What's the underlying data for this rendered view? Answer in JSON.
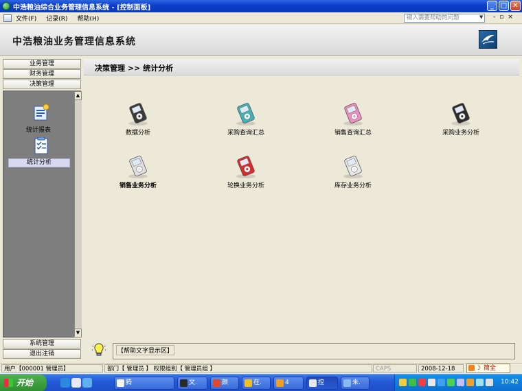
{
  "window": {
    "title": "中浩粮油综合业务管理信息系统 - [控制面板]",
    "controls": [
      "_",
      "□",
      "✕"
    ]
  },
  "menubar": {
    "items": [
      {
        "label": "文件(F)"
      },
      {
        "label": "记录(R)"
      },
      {
        "label": "帮助(H)"
      }
    ],
    "help_placeholder": "键入需要帮助的问题",
    "mdi_controls": [
      "-",
      "▫",
      "×"
    ]
  },
  "header": {
    "app_title": "中浩粮油业务管理信息系统"
  },
  "sidebar": {
    "top_tabs": [
      {
        "label": "业务管理"
      },
      {
        "label": "财务管理"
      },
      {
        "label": "决策管理"
      }
    ],
    "panel_items": [
      {
        "label": "统计报表",
        "icon": "report-icon"
      },
      {
        "label": "统计分析",
        "icon": "analysis-icon",
        "selected": true
      }
    ],
    "bottom_tabs": [
      {
        "label": "系统管理"
      },
      {
        "label": "退出注销"
      }
    ]
  },
  "main": {
    "breadcrumb": "决策管理 >> 统计分析",
    "tiles": [
      {
        "label": "数据分析",
        "color": "#3a3a3a"
      },
      {
        "label": "采购查询汇总",
        "color": "#3fb3b8"
      },
      {
        "label": "销售查询汇总",
        "color": "#f08cc0"
      },
      {
        "label": "采购业务分析",
        "color": "#2c2c2c"
      },
      {
        "label": "销售业务分析",
        "color": "#e0e0e0"
      },
      {
        "label": "轮换业务分析",
        "color": "#e02828"
      },
      {
        "label": "库存业务分析",
        "color": "#e8e8e8"
      }
    ]
  },
  "help_area": {
    "label": "【帮助文字显示区】"
  },
  "status": {
    "user": "用户【000001 管理员】",
    "dept": "部门【 管理员 】 权限组别【 管理员组 】",
    "caps": "CAPS",
    "date": "2008-12-18"
  },
  "ime": {
    "text": "简全"
  },
  "taskbar": {
    "start_label": "开始",
    "tasks": [
      {
        "label": "腾",
        "color": "#f5f5f5"
      },
      {
        "label": "文.",
        "color": "#2a2a2a"
      },
      {
        "label": "颜",
        "color": "#e04a2a"
      },
      {
        "label": "在.",
        "color": "#f0c020"
      },
      {
        "label": "4",
        "color": "#f0a020"
      },
      {
        "label": "控",
        "color": "#e8e8e8"
      },
      {
        "label": "未.",
        "color": "#8ab8f0"
      }
    ],
    "clock": "10:42"
  }
}
